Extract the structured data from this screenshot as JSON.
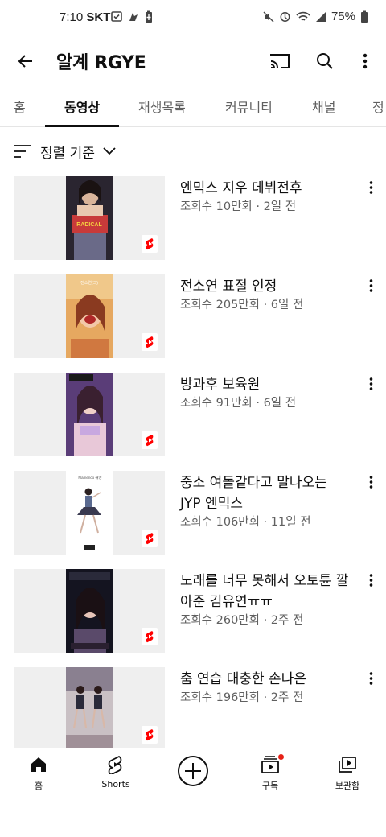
{
  "status_bar": {
    "time": "7:10",
    "carrier": "SKT",
    "battery": "75%"
  },
  "header": {
    "channel_name": "알계 RGYE"
  },
  "tabs": [
    {
      "label": "홈",
      "active": false
    },
    {
      "label": "동영상",
      "active": true
    },
    {
      "label": "재생목록",
      "active": false
    },
    {
      "label": "커뮤니티",
      "active": false
    },
    {
      "label": "채널",
      "active": false
    },
    {
      "label": "정",
      "active": false
    }
  ],
  "sort": {
    "label": "정렬 기준"
  },
  "videos": [
    {
      "title": "엔믹스 지우 데뷔전후",
      "meta": "조회수 10만회 · 2일 전",
      "thumb_colors": [
        "#3a2a2a",
        "#c8a88a",
        "#6a6a80"
      ]
    },
    {
      "title": "전소연 표절 인정",
      "meta": "조회수 205만회 · 6일 전",
      "thumb_colors": [
        "#d8a060",
        "#f0c080",
        "#c07040"
      ]
    },
    {
      "title": "방과후 보육원",
      "meta": "조회수 91만회 · 6일 전",
      "thumb_colors": [
        "#5a3a70",
        "#e8c0d0",
        "#b08090"
      ]
    },
    {
      "title": "중소 여돌같다고 말나오는 JYP 엔믹스",
      "meta": "조회수 106만회 · 11일 전",
      "thumb_colors": [
        "#ffffff",
        "#4a5a80",
        "#333333"
      ]
    },
    {
      "title": "노래를 너무 못해서 오토튠 깔아준 김유연ㅠㅠ",
      "meta": "조회수 260만회 · 2주 전",
      "thumb_colors": [
        "#1a1a2a",
        "#5a4a6a",
        "#8a6a7a"
      ]
    },
    {
      "title": "춤 연습 대충한 손나은",
      "meta": "조회수 196만회 · 2주 전",
      "thumb_colors": [
        "#d0c8c8",
        "#3a3030",
        "#8a7070"
      ]
    }
  ],
  "bottom_nav": [
    {
      "label": "홈",
      "icon": "home-icon"
    },
    {
      "label": "Shorts",
      "icon": "shorts-icon"
    },
    {
      "label": "",
      "icon": "create-icon"
    },
    {
      "label": "구독",
      "icon": "subscriptions-icon"
    },
    {
      "label": "보관함",
      "icon": "library-icon"
    }
  ],
  "colors": {
    "shorts_red": "#ff0000",
    "text_primary": "#0f0f0f",
    "text_secondary": "#606060",
    "notification_red": "#e62117"
  }
}
